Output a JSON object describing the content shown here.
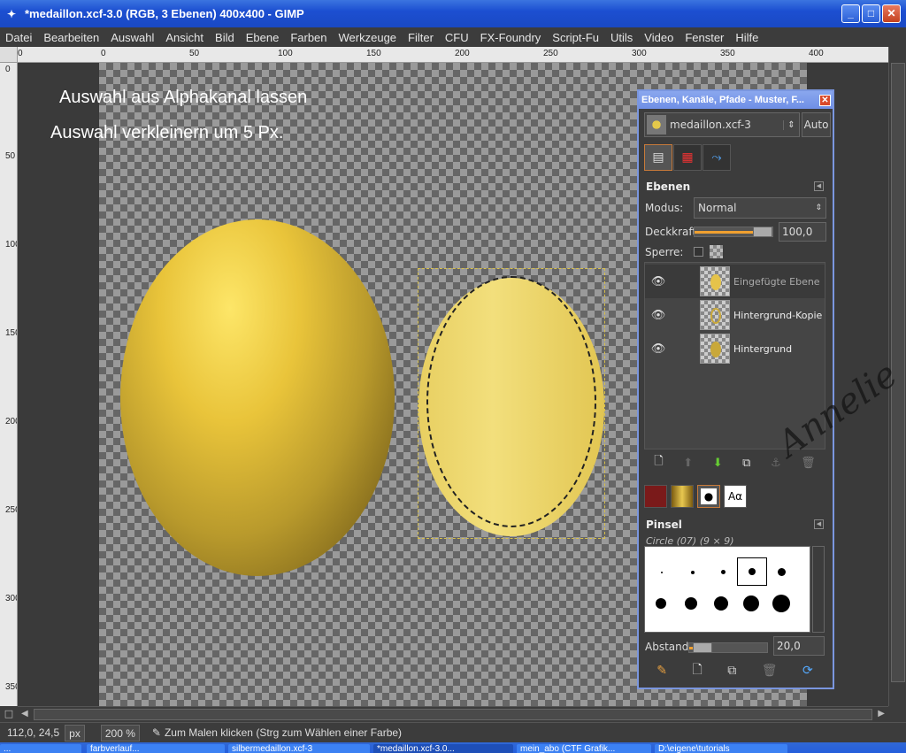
{
  "window": {
    "title": "*medaillon.xcf-3.0 (RGB, 3 Ebenen) 400x400 - GIMP",
    "app_icon": "gimp-icon",
    "controls": {
      "minimize": "_",
      "maximize": "□",
      "close": "✕"
    }
  },
  "menu": [
    "Datei",
    "Bearbeiten",
    "Auswahl",
    "Ansicht",
    "Bild",
    "Ebene",
    "Farben",
    "Werkzeuge",
    "Filter",
    "CFU",
    "FX-Foundry",
    "Script-Fu",
    "Utils",
    "Video",
    "Fenster",
    "Hilfe"
  ],
  "ruler": {
    "h_labels": [
      "0",
      "50",
      "100",
      "150",
      "200",
      "250",
      "300",
      "350",
      "400"
    ],
    "v_labels": [
      "0",
      "50",
      "100",
      "150",
      "200",
      "250",
      "300",
      "350"
    ]
  },
  "canvas": {
    "text1": "Auswahl aus Alphakanal lassen",
    "text2": "Auswahl verkleinern um 5 Px."
  },
  "status": {
    "coords": "112,0, 24,5",
    "unit": "px",
    "zoom": "200 %",
    "message": "Zum Malen klicken (Strg zum Wählen einer Farbe)"
  },
  "dock": {
    "title": "Ebenen, Kanäle, Pfade - Muster, F...",
    "image_name": "medaillon.xcf-3",
    "auto_label": "Auto",
    "layers_title": "Ebenen",
    "mode_label": "Modus:",
    "mode_value": "Normal",
    "opacity_label": "Deckkraft:",
    "opacity_value": "100,0",
    "opacity_fraction": 1.0,
    "lock_label": "Sperre:",
    "layers": [
      {
        "name": "Eingefügte Ebene",
        "visible": true,
        "selected": true
      },
      {
        "name": "Hintergrund-Kopie",
        "visible": true,
        "selected": false
      },
      {
        "name": "Hintergrund",
        "visible": true,
        "selected": false
      }
    ],
    "brushes_title": "Pinsel",
    "brush_name": "Circle (07) (9 × 9)",
    "spacing_label": "Abstand:",
    "spacing_value": "20,0",
    "font_tab_label": "Aα"
  },
  "taskbar": [
    "...",
    "farbverlauf...",
    "silbermedaillon.xcf-3",
    "*medaillon.xcf-3.0...",
    "mein_abo (CTF Grafik...",
    "D:\\eigene\\tutorials"
  ]
}
